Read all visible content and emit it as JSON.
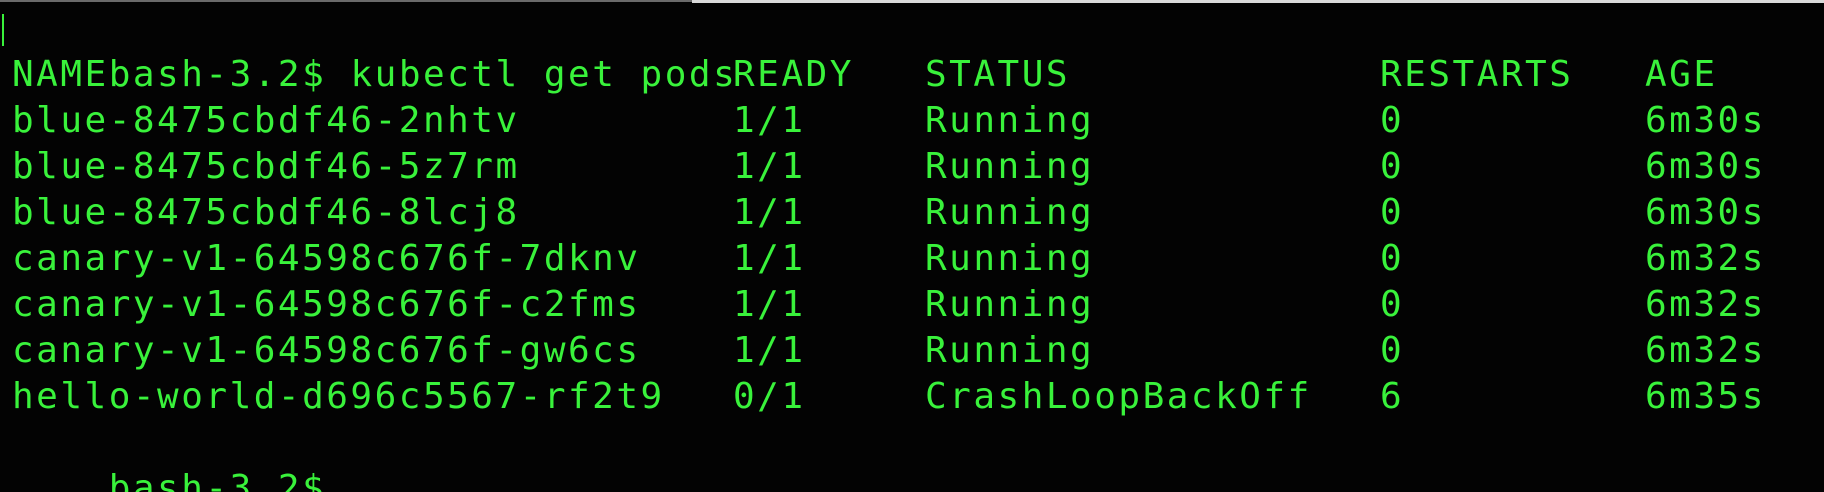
{
  "prompt": "bash-3.2$",
  "command": "kubectl get pods",
  "headers": {
    "name": "NAME",
    "ready": "READY",
    "status": "STATUS",
    "restarts": "RESTARTS",
    "age": "AGE"
  },
  "rows": [
    {
      "name": "blue-8475cbdf46-2nhtv",
      "ready": "1/1",
      "status": "Running",
      "restarts": "0",
      "age": "6m30s"
    },
    {
      "name": "blue-8475cbdf46-5z7rm",
      "ready": "1/1",
      "status": "Running",
      "restarts": "0",
      "age": "6m30s"
    },
    {
      "name": "blue-8475cbdf46-8lcj8",
      "ready": "1/1",
      "status": "Running",
      "restarts": "0",
      "age": "6m30s"
    },
    {
      "name": "canary-v1-64598c676f-7dknv",
      "ready": "1/1",
      "status": "Running",
      "restarts": "0",
      "age": "6m32s"
    },
    {
      "name": "canary-v1-64598c676f-c2fms",
      "ready": "1/1",
      "status": "Running",
      "restarts": "0",
      "age": "6m32s"
    },
    {
      "name": "canary-v1-64598c676f-gw6cs",
      "ready": "1/1",
      "status": "Running",
      "restarts": "0",
      "age": "6m32s"
    },
    {
      "name": "hello-world-d696c5567-rf2t9",
      "ready": "0/1",
      "status": "CrashLoopBackOff",
      "restarts": "6",
      "age": "6m35s"
    }
  ],
  "final_prompt": "bash-3.2$",
  "colors": {
    "background": "#030303",
    "text": "#39f23b"
  }
}
